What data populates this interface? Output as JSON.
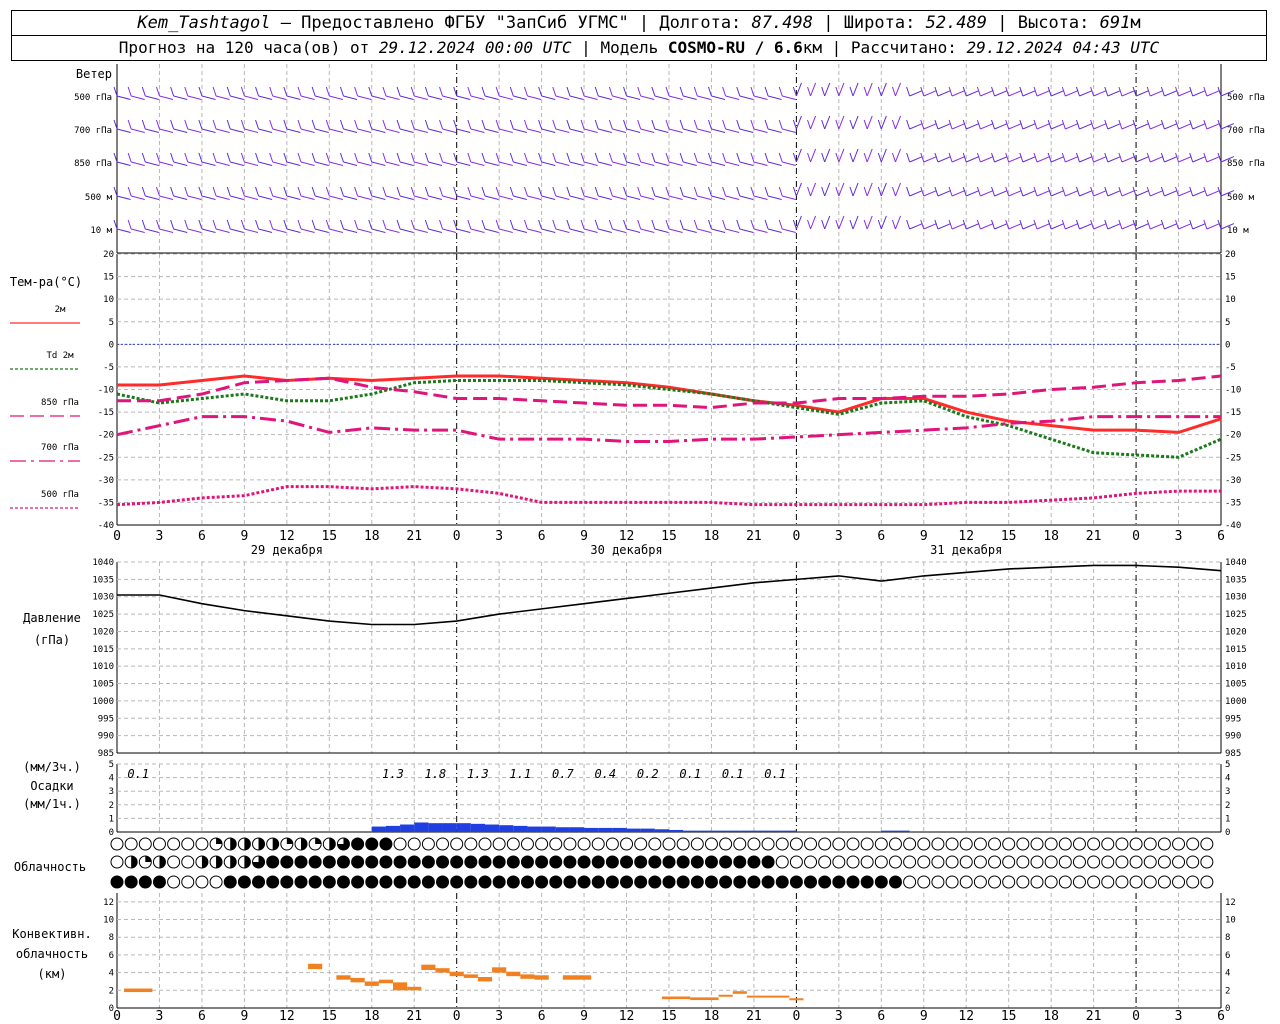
{
  "header": {
    "station": "Kem_Tashtagol",
    "provider_text": "Предоставлено ФГБУ \"ЗапСиб УГМС\"",
    "lon_label": "Долгота:",
    "lon_value": "87.498",
    "lat_label": "Широта:",
    "lat_value": "52.489",
    "alt_label": "Высота:",
    "alt_value": "691",
    "alt_unit": "м",
    "forecast_prefix": "Прогноз на 120 часа(ов) от",
    "forecast_time": "29.12.2024 00:00 UTC",
    "model_label": "Модель",
    "model_name": "COSMO-RU / 6.6",
    "model_unit": "км",
    "calc_label": "Рассчитано:",
    "calc_time": "29.12.2024 04:43 UTC"
  },
  "chart_data": [
    {
      "type": "wind-barbs",
      "title": "Ветер",
      "levels": [
        "500 гПа",
        "700 гПа",
        "850 гПа",
        "500 м",
        "10 м"
      ],
      "colors": {
        "barb_a": "#8a2be2",
        "barb_b": "#5f2bd6"
      }
    },
    {
      "type": "line",
      "title": "Тем-ра(°С)",
      "ylim": [
        -40,
        20
      ],
      "yticks": [
        20,
        15,
        10,
        5,
        0,
        -5,
        -10,
        -15,
        -20,
        -25,
        -30,
        -35,
        -40
      ],
      "x_hours": [
        0,
        3,
        6,
        9,
        12,
        15,
        18,
        21,
        24,
        27,
        30,
        33,
        36,
        39,
        42,
        45,
        48,
        51,
        54,
        57,
        60,
        63,
        66,
        69,
        72,
        75,
        78
      ],
      "series": [
        {
          "name": "2м",
          "color": "#ff2a2a",
          "style": "solid",
          "values": [
            -9,
            -9,
            -8,
            -7,
            -8,
            -7.5,
            -8,
            -7.5,
            -7,
            -7,
            -7.5,
            -8,
            -8.5,
            -9.5,
            -11,
            -12.5,
            -13.5,
            -15,
            -12,
            -12,
            -15,
            -17,
            -18,
            -19,
            -19,
            -19.5,
            -16.5
          ]
        },
        {
          "name": "Td 2м",
          "color": "#1a7a1a",
          "style": "dotted",
          "values": [
            -11,
            -13,
            -12,
            -11,
            -12.5,
            -12.5,
            -11,
            -8.5,
            -8,
            -8,
            -8,
            -8.5,
            -9,
            -10,
            -11,
            -12.5,
            -14,
            -15.5,
            -13,
            -12.5,
            -16,
            -18,
            -21,
            -24,
            -24.5,
            -25,
            -21
          ]
        },
        {
          "name": "850 гПа",
          "color": "#e0147a",
          "style": "dashed",
          "values": [
            -12.5,
            -12.5,
            -11,
            -8.5,
            -8,
            -7.5,
            -9.5,
            -10.5,
            -12,
            -12,
            -12.5,
            -13,
            -13.5,
            -13.5,
            -14,
            -13,
            -13,
            -12,
            -12,
            -11.5,
            -11.5,
            -11,
            -10,
            -9.5,
            -8.5,
            -8,
            -7
          ]
        },
        {
          "name": "700 гПа",
          "color": "#e0147a",
          "style": "dashdot",
          "values": [
            -20,
            -18,
            -16,
            -16,
            -17,
            -19.5,
            -18.5,
            -19,
            -19,
            -21,
            -21,
            -21,
            -21.5,
            -21.5,
            -21,
            -21,
            -20.5,
            -20,
            -19.5,
            -19,
            -18.5,
            -17.5,
            -17,
            -16,
            -16,
            -16,
            -16
          ]
        },
        {
          "name": "500 гПа",
          "color": "#e0147a",
          "style": "dotted",
          "values": [
            -35.5,
            -35,
            -34,
            -33.5,
            -31.5,
            -31.5,
            -32,
            -31.5,
            -32,
            -33,
            -35,
            -35,
            -35,
            -35,
            -35,
            -35.5,
            -35.5,
            -35.5,
            -35.5,
            -35.5,
            -35,
            -35,
            -34.5,
            -34,
            -33,
            -32.5,
            -32.5
          ]
        }
      ]
    },
    {
      "type": "line",
      "title": "Давление",
      "unit": "(гПа)",
      "ylim": [
        985,
        1040
      ],
      "yticks": [
        1040,
        1035,
        1030,
        1025,
        1020,
        1015,
        1010,
        1005,
        1000,
        995,
        990,
        985
      ],
      "series": [
        {
          "color": "#000000",
          "values": [
            1030.5,
            1030.5,
            1028,
            1026,
            1024.5,
            1023,
            1022,
            1022,
            1023,
            1025,
            1026.5,
            1028,
            1029.5,
            1031,
            1032.5,
            1034,
            1035,
            1036,
            1034.5,
            1036,
            1037,
            1038,
            1038.5,
            1039,
            1039,
            1038.5,
            1037.5
          ]
        }
      ]
    },
    {
      "type": "bar",
      "title": "Осадки",
      "unit_3h": "(мм/3ч.)",
      "unit_1h": "(мм/1ч.)",
      "ylim": [
        0,
        5
      ],
      "yticks": [
        5,
        4,
        3,
        2,
        1,
        0
      ],
      "labels_3h": [
        {
          "hour": 1.5,
          "text": "0.1"
        },
        {
          "hour": 19.5,
          "text": "1.3"
        },
        {
          "hour": 22.5,
          "text": "1.8"
        },
        {
          "hour": 25.5,
          "text": "1.3"
        },
        {
          "hour": 28.5,
          "text": "1.1"
        },
        {
          "hour": 31.5,
          "text": "0.7"
        },
        {
          "hour": 34.5,
          "text": "0.4"
        },
        {
          "hour": 37.5,
          "text": "0.2"
        },
        {
          "hour": 40.5,
          "text": "0.1"
        },
        {
          "hour": 43.5,
          "text": "0.1"
        },
        {
          "hour": 46.5,
          "text": "0.1"
        }
      ],
      "hourly_values": [
        0,
        0.05,
        0.05,
        0.05,
        0.05,
        0,
        0,
        0,
        0,
        0,
        0,
        0,
        0,
        0,
        0,
        0,
        0,
        0,
        0.4,
        0.45,
        0.55,
        0.7,
        0.65,
        0.65,
        0.65,
        0.6,
        0.55,
        0.5,
        0.45,
        0.4,
        0.4,
        0.35,
        0.35,
        0.3,
        0.3,
        0.3,
        0.25,
        0.25,
        0.2,
        0.15,
        0.1,
        0.1,
        0.1,
        0.1,
        0.1,
        0.1,
        0.1,
        0.1,
        0.05,
        0.05,
        0.05,
        0.05,
        0.05,
        0.05,
        0.1,
        0.1,
        0.05,
        0.05,
        0,
        0,
        0,
        0,
        0,
        0,
        0,
        0,
        0,
        0,
        0,
        0,
        0,
        0,
        0,
        0,
        0,
        0,
        0,
        0
      ],
      "color": "#1f3fe0"
    },
    {
      "type": "table",
      "title": "Облачность",
      "rows": [
        "000000012222121234440000000000000000000000000000000000000000000000000000000000",
        "021200222234444444444444444444444444444444444440000000000000000000000000000000",
        "444400004444444444444444444444444444444444444444444444440000000000000000000000"
      ]
    },
    {
      "type": "bar",
      "title": "Конвективн. облачность",
      "unit": "(км)",
      "ylim": [
        0,
        13
      ],
      "yticks": [
        12,
        10,
        8,
        6,
        4,
        2,
        0
      ],
      "color": "#f08020",
      "segments": [
        {
          "x0": 0.5,
          "x1": 2.5,
          "bottom": 1.8,
          "top": 2.2
        },
        {
          "x0": 13.5,
          "x1": 14.5,
          "bottom": 4.4,
          "top": 5.0
        },
        {
          "x0": 15.5,
          "x1": 16.5,
          "bottom": 3.2,
          "top": 3.7
        },
        {
          "x0": 16.5,
          "x1": 17.5,
          "bottom": 2.9,
          "top": 3.4
        },
        {
          "x0": 17.5,
          "x1": 18.5,
          "bottom": 2.5,
          "top": 3.0
        },
        {
          "x0": 18.5,
          "x1": 19.5,
          "bottom": 2.8,
          "top": 3.2
        },
        {
          "x0": 19.5,
          "x1": 20.5,
          "bottom": 2.0,
          "top": 2.9
        },
        {
          "x0": 20.5,
          "x1": 21.5,
          "bottom": 2.0,
          "top": 2.4
        },
        {
          "x0": 21.5,
          "x1": 22.5,
          "bottom": 4.3,
          "top": 4.9
        },
        {
          "x0": 22.5,
          "x1": 23.5,
          "bottom": 4.0,
          "top": 4.5
        },
        {
          "x0": 23.5,
          "x1": 24.5,
          "bottom": 3.6,
          "top": 4.1
        },
        {
          "x0": 24.5,
          "x1": 25.5,
          "bottom": 3.4,
          "top": 3.8
        },
        {
          "x0": 25.5,
          "x1": 26.5,
          "bottom": 3.0,
          "top": 3.5
        },
        {
          "x0": 26.5,
          "x1": 27.5,
          "bottom": 4.0,
          "top": 4.6
        },
        {
          "x0": 27.5,
          "x1": 28.5,
          "bottom": 3.6,
          "top": 4.1
        },
        {
          "x0": 28.5,
          "x1": 29.5,
          "bottom": 3.3,
          "top": 3.8
        },
        {
          "x0": 29.5,
          "x1": 30.5,
          "bottom": 3.2,
          "top": 3.7
        },
        {
          "x0": 31.5,
          "x1": 33.5,
          "bottom": 3.2,
          "top": 3.7
        },
        {
          "x0": 38.5,
          "x1": 40.5,
          "bottom": 1.0,
          "top": 1.3
        },
        {
          "x0": 40.5,
          "x1": 42.5,
          "bottom": 0.9,
          "top": 1.2
        },
        {
          "x0": 42.5,
          "x1": 43.5,
          "bottom": 1.3,
          "top": 1.5
        },
        {
          "x0": 43.5,
          "x1": 44.5,
          "bottom": 1.6,
          "top": 1.9
        },
        {
          "x0": 44.5,
          "x1": 47.5,
          "bottom": 1.2,
          "top": 1.4
        },
        {
          "x0": 47.5,
          "x1": 48.5,
          "bottom": 0.9,
          "top": 1.1
        }
      ]
    }
  ],
  "x_axis": {
    "tick_labels": [
      "0",
      "3",
      "6",
      "9",
      "12",
      "15",
      "18",
      "21",
      "0",
      "3",
      "6",
      "9",
      "12",
      "15",
      "18",
      "21",
      "0",
      "3",
      "6",
      "9",
      "12",
      "15",
      "18",
      "21",
      "0",
      "3",
      "6"
    ],
    "dates": [
      "29 декабря",
      "30 декабря",
      "31 декабря"
    ]
  }
}
